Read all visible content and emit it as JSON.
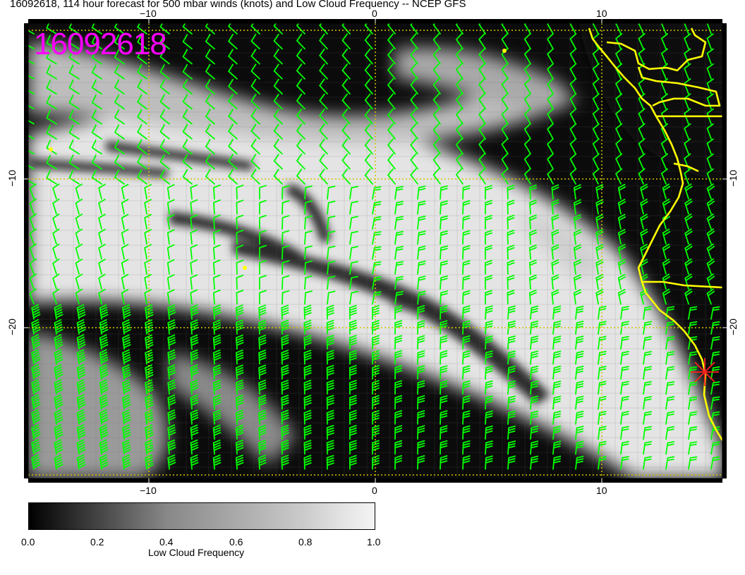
{
  "title": "16092618, 114 hour forecast for 500 mbar winds (knots) and Low Cloud Frequency -- NCEP GFS",
  "stamp": "16092618",
  "axes": {
    "top_ticks": [
      "−10",
      "0",
      "10"
    ],
    "bottom_ticks": [
      "−10",
      "0",
      "10"
    ],
    "left_ticks": [
      "−10",
      "−20"
    ],
    "right_ticks": [
      "−10",
      "−20"
    ]
  },
  "colorbar": {
    "title": "Low Cloud Frequency",
    "ticks": [
      "0.0",
      "0.2",
      "0.4",
      "0.6",
      "0.8",
      "1.0"
    ],
    "range": [
      0.0,
      1.0
    ]
  },
  "colors": {
    "wind_barbs": "#00ff00",
    "coastline": "#ffff00",
    "grid": "#d4c400",
    "stamp": "#ff00ff",
    "marker": "#ff2020"
  },
  "icons": {
    "marker": "red-asterisk-icon"
  }
}
